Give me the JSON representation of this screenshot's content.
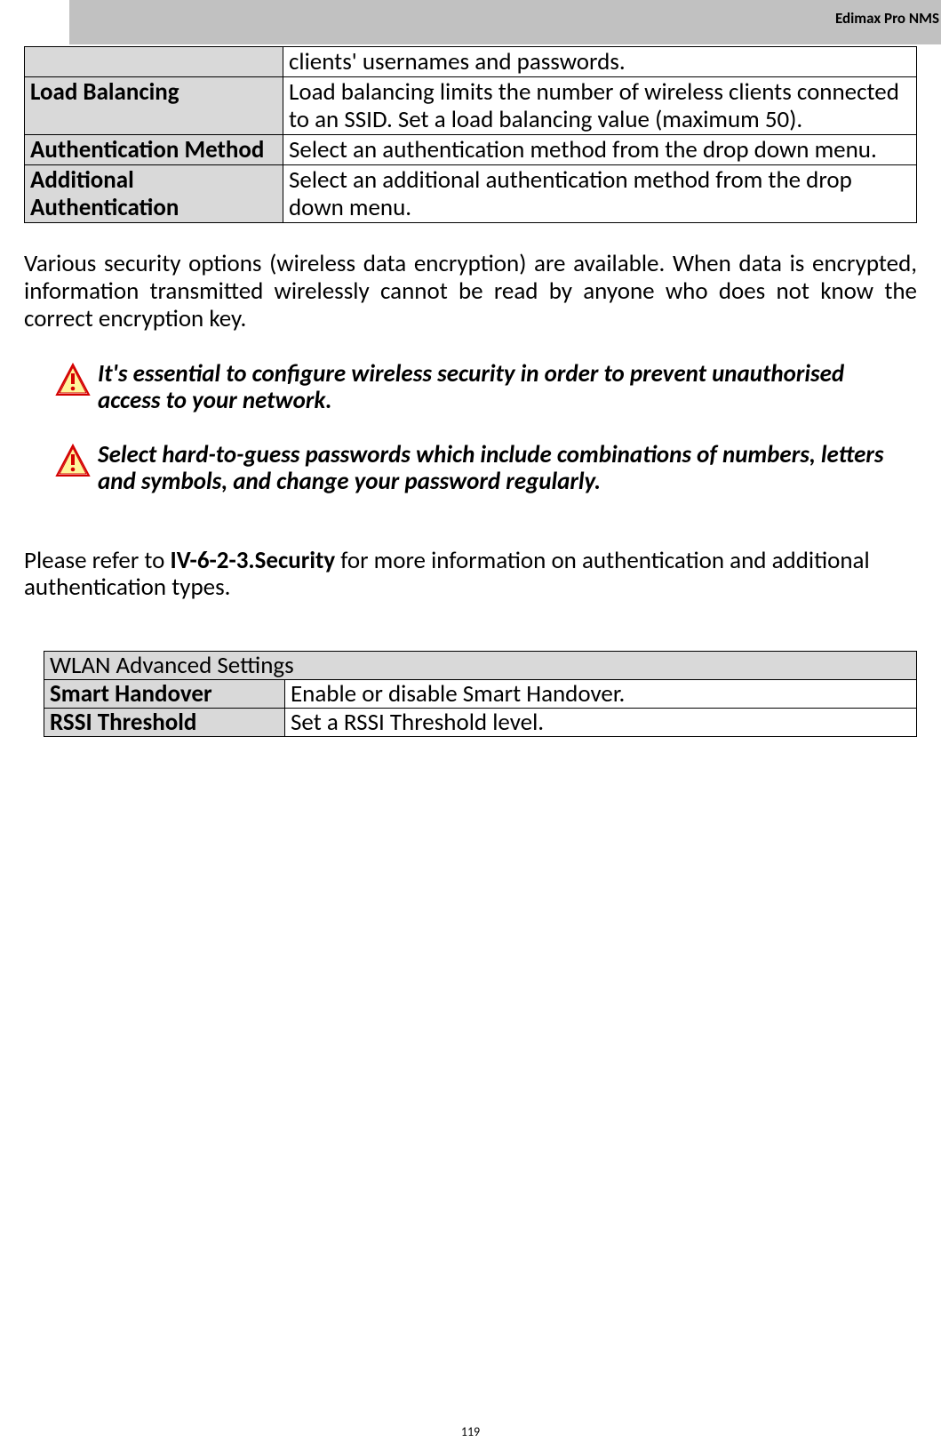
{
  "header": {
    "title": "Edimax Pro NMS"
  },
  "table1": {
    "rows": [
      {
        "label": "",
        "desc": "clients' usernames and passwords."
      },
      {
        "label": "Load Balancing",
        "desc": "Load balancing limits the number of wireless clients connected to an SSID. Set a load balancing value (maximum 50)."
      },
      {
        "label": "Authentication Method",
        "desc": "Select an authentication method from the drop down menu."
      },
      {
        "label": "Additional Authentication",
        "desc": "Select an additional authentication method from the drop down menu."
      }
    ]
  },
  "para1": "Various security options (wireless data encryption) are available. When data is encrypted, information transmitted wirelessly cannot be read by anyone who does not know the correct encryption key.",
  "warnings": [
    "It's essential to configure wireless security in order to prevent unauthorised access to your network.",
    "Select hard-to-guess passwords which include combinations of numbers, letters and symbols, and change your password regularly."
  ],
  "refer": {
    "pre": "Please refer to ",
    "bold": "IV-6-2-3.Security",
    "post": " for more information on authentication and additional authentication types."
  },
  "table2": {
    "header": "WLAN Advanced Settings",
    "rows": [
      {
        "label": "Smart Handover",
        "desc": "Enable or disable Smart Handover."
      },
      {
        "label": "RSSI Threshold",
        "desc": "Set a RSSI Threshold level."
      }
    ]
  },
  "page_number": "119"
}
